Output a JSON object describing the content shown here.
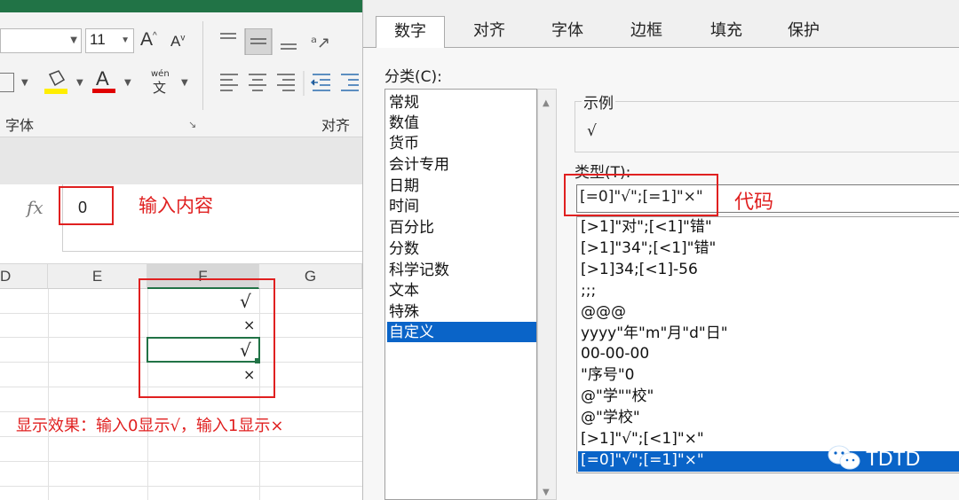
{
  "excel": {
    "font_size": "11",
    "font_group_label": "字体",
    "align_group_label": "对齐方",
    "fx_label": "fx",
    "formula_value": "0",
    "formula_annotation": "输入内容",
    "columns": [
      "D",
      "E",
      "F",
      "G"
    ],
    "cells": [
      "√",
      "×",
      "√",
      "×"
    ],
    "result_annotation": "显示效果：输入0显示√，输入1显示×",
    "icons": {
      "increase_font": "A",
      "decrease_font": "A",
      "font_color": "A",
      "phonetic": "wén",
      "phonetic_char": "文"
    }
  },
  "dialog": {
    "tabs": [
      "数字",
      "对齐",
      "字体",
      "边框",
      "填充",
      "保护"
    ],
    "category_label": "分类(C):",
    "categories": [
      "常规",
      "数值",
      "货币",
      "会计专用",
      "日期",
      "时间",
      "百分比",
      "分数",
      "科学记数",
      "文本",
      "特殊",
      "自定义"
    ],
    "selected_category": "自定义",
    "sample_label": "示例",
    "sample_value": "√",
    "type_label": "类型(T):",
    "type_value": "[=0]\"√\";[=1]\"×\"",
    "code_annotation": "代码",
    "formats": [
      "[>1]\"对\";[<1]\"错\"",
      "[>1]\"34\";[<1]\"错\"",
      "[>1]34;[<1]-56",
      ";;;",
      "@@@",
      "yyyy\"年\"m\"月\"d\"日\"",
      "00-00-00",
      "\"序号\"0",
      "@\"学\"\"校\"",
      "@\"学校\"",
      "[>1]\"√\";[<1]\"×\"",
      "[=0]\"√\";[=1]\"×\""
    ],
    "watermark": "TDTD"
  },
  "colors": {
    "accent_red": "#e02020",
    "selection_blue": "#0a64c8",
    "excel_green": "#217346"
  }
}
